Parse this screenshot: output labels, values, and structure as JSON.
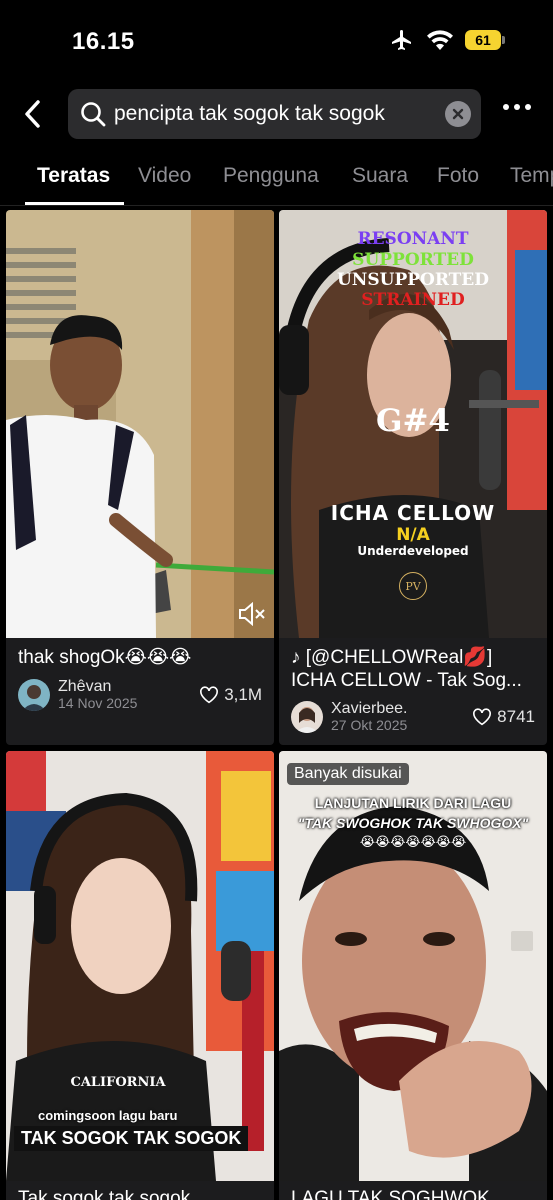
{
  "status_bar": {
    "time": "16.15",
    "battery": "61"
  },
  "search": {
    "query": "pencipta tak sogok tak sogok"
  },
  "tabs": [
    "Teratas",
    "Video",
    "Pengguna",
    "Suara",
    "Foto",
    "Temp"
  ],
  "results": [
    {
      "caption": "thak shogOk😭😭😭",
      "author": "Zhêvan",
      "date": "14 Nov 2025",
      "likes": "3,1M"
    },
    {
      "caption": "♪ [@CHELLOWReal💋] ICHA CELLOW - Tak Sog...",
      "author": "Xavierbee.",
      "date": "27 Okt 2025",
      "likes": "8741",
      "overlay": {
        "resonant": "RESONANT",
        "supported": "SUPPORTED",
        "unsupported": "UNSUPPORTED",
        "strained": "STRAINED",
        "note": "G#4",
        "name": "ICHA CELLOW",
        "na": "N/A",
        "level": "Underdeveloped",
        "logo": "PV"
      }
    },
    {
      "caption": "Tak sogok tak sogok",
      "overlay": {
        "small": "comingsoon lagu baru",
        "big": "TAK SOGOK TAK SOGOK",
        "shirt": "CALIFORNIA"
      }
    },
    {
      "caption": "LAGU TAK SOGHWOK",
      "badge": "Banyak disukai",
      "overlay": {
        "line1": "LANJUTAN LIRIK DARI LAGU",
        "line2": "\"TAK SWOGHOK TAK SWHOGOX\"",
        "emoji": "😭😭😭😭😭😭😭"
      }
    }
  ],
  "colors": {
    "accent_battery": "#f6d430",
    "resonant": "#7b3ff2",
    "supported": "#7ee23a",
    "strained": "#e02020"
  }
}
